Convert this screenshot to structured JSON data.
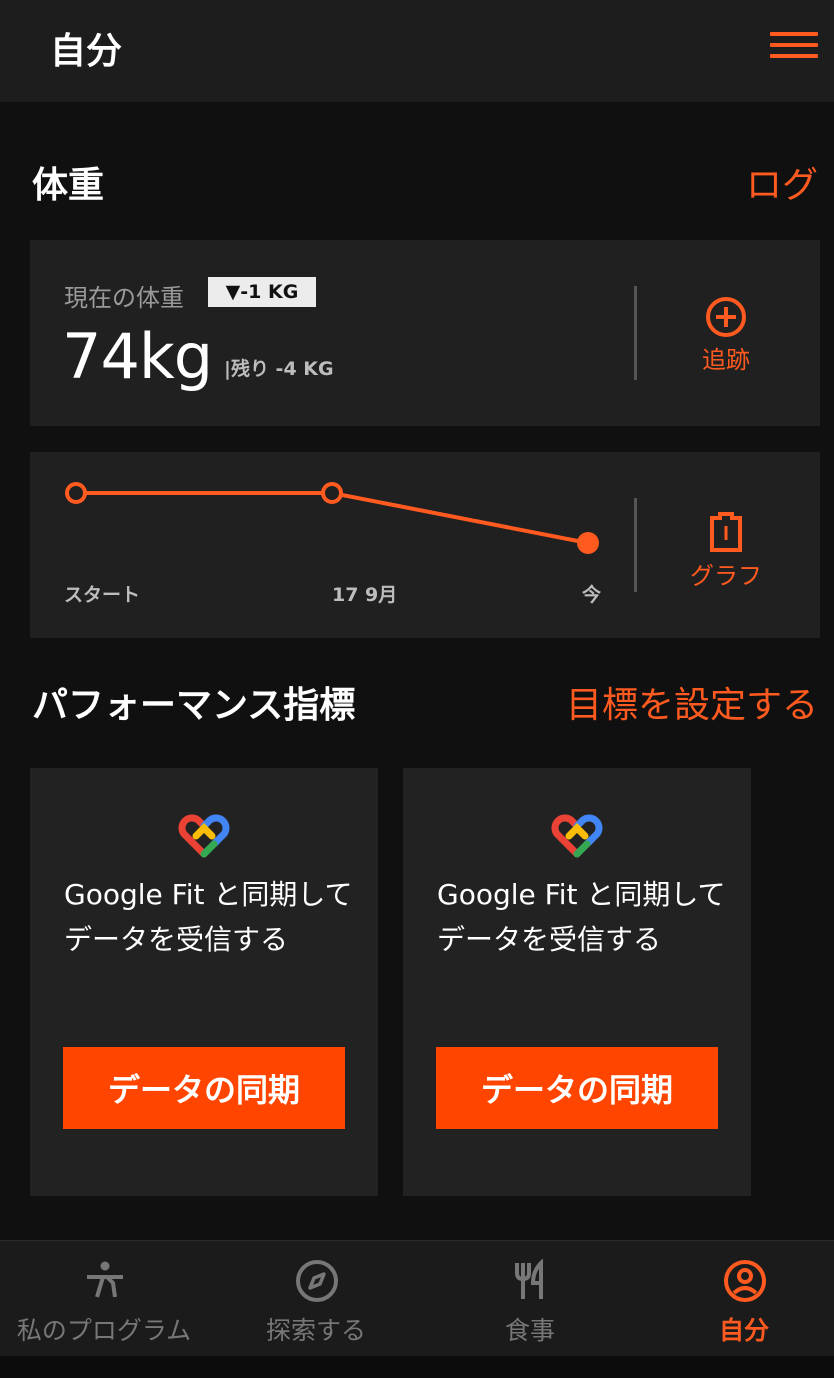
{
  "header": {
    "title": "自分",
    "menu_icon": "hamburger-menu-icon"
  },
  "weight_section": {
    "title": "体重",
    "log_link": "ログ",
    "current_label": "現在の体重",
    "delta_badge": "▼-1 KG",
    "current_value": "74kg",
    "remaining": "|残り -4 KG",
    "track_label": "追跡",
    "track_icon": "plus-circle-icon"
  },
  "chart_section": {
    "graph_label": "グラフ",
    "graph_icon": "clipboard-icon"
  },
  "chart_data": {
    "type": "line",
    "categories": [
      "スタート",
      "17 9月",
      "今"
    ],
    "values": [
      75,
      75,
      74
    ],
    "xlabel": "",
    "ylabel": "",
    "grid": false,
    "line_color": "#ff5a1f"
  },
  "performance_section": {
    "title": "パフォーマンス指標",
    "set_goal_link": "目標を設定する",
    "cards": [
      {
        "icon": "google-fit-heart-icon",
        "text": "Google Fit と同期してデータを受信する",
        "button": "データの同期"
      },
      {
        "icon": "google-fit-heart-icon",
        "text": "Google Fit と同期してデータを受信する",
        "button": "データの同期"
      }
    ]
  },
  "tabbar": {
    "tabs": [
      {
        "label": "私のプログラム",
        "icon": "exercise-person-icon",
        "active": false
      },
      {
        "label": "探索する",
        "icon": "compass-icon",
        "active": false
      },
      {
        "label": "食事",
        "icon": "fork-knife-icon",
        "active": false
      },
      {
        "label": "自分",
        "icon": "profile-icon",
        "active": true
      }
    ]
  },
  "colors": {
    "accent": "#ff5a1f",
    "button": "#ff4500",
    "background": "#101010",
    "card": "#202020"
  }
}
